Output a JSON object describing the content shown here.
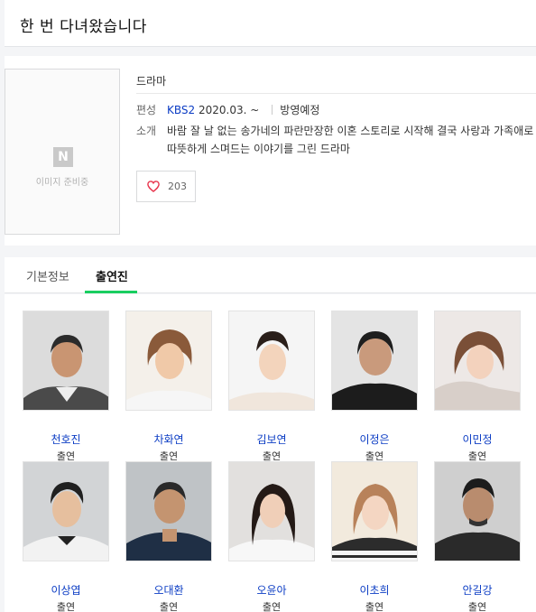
{
  "page": {
    "title": "한 번 다녀왔습니다"
  },
  "poster": {
    "badge": "N",
    "placeholder": "이미지 준비중"
  },
  "info": {
    "genre": "드라마",
    "schedule_label": "편성",
    "network": "KBS2",
    "date": "2020.03. ~",
    "status": "방영예정",
    "intro_label": "소개",
    "intro": "바람 잘 날 없는 송가네의 파란만장한 이혼 스토리로 시작해 결국 사랑과 가족애로 따뜻하게 스며드는 이야기를 그린 드라마"
  },
  "like": {
    "icon": "heart-icon",
    "count": "203"
  },
  "tabs": [
    {
      "label": "기본정보",
      "active": false
    },
    {
      "label": "출연진",
      "active": true
    }
  ],
  "colors": {
    "accent_green": "#19ce60",
    "link_blue": "#0b3cc4"
  },
  "cast": [
    {
      "name": "천호진",
      "role": "출연"
    },
    {
      "name": "차화연",
      "role": "출연"
    },
    {
      "name": "김보연",
      "role": "출연"
    },
    {
      "name": "이정은",
      "role": "출연"
    },
    {
      "name": "이민정",
      "role": "출연"
    },
    {
      "name": "이상엽",
      "role": "출연"
    },
    {
      "name": "오대환",
      "role": "출연"
    },
    {
      "name": "오윤아",
      "role": "출연"
    },
    {
      "name": "이초희",
      "role": "출연"
    },
    {
      "name": "안길강",
      "role": "출연"
    }
  ]
}
